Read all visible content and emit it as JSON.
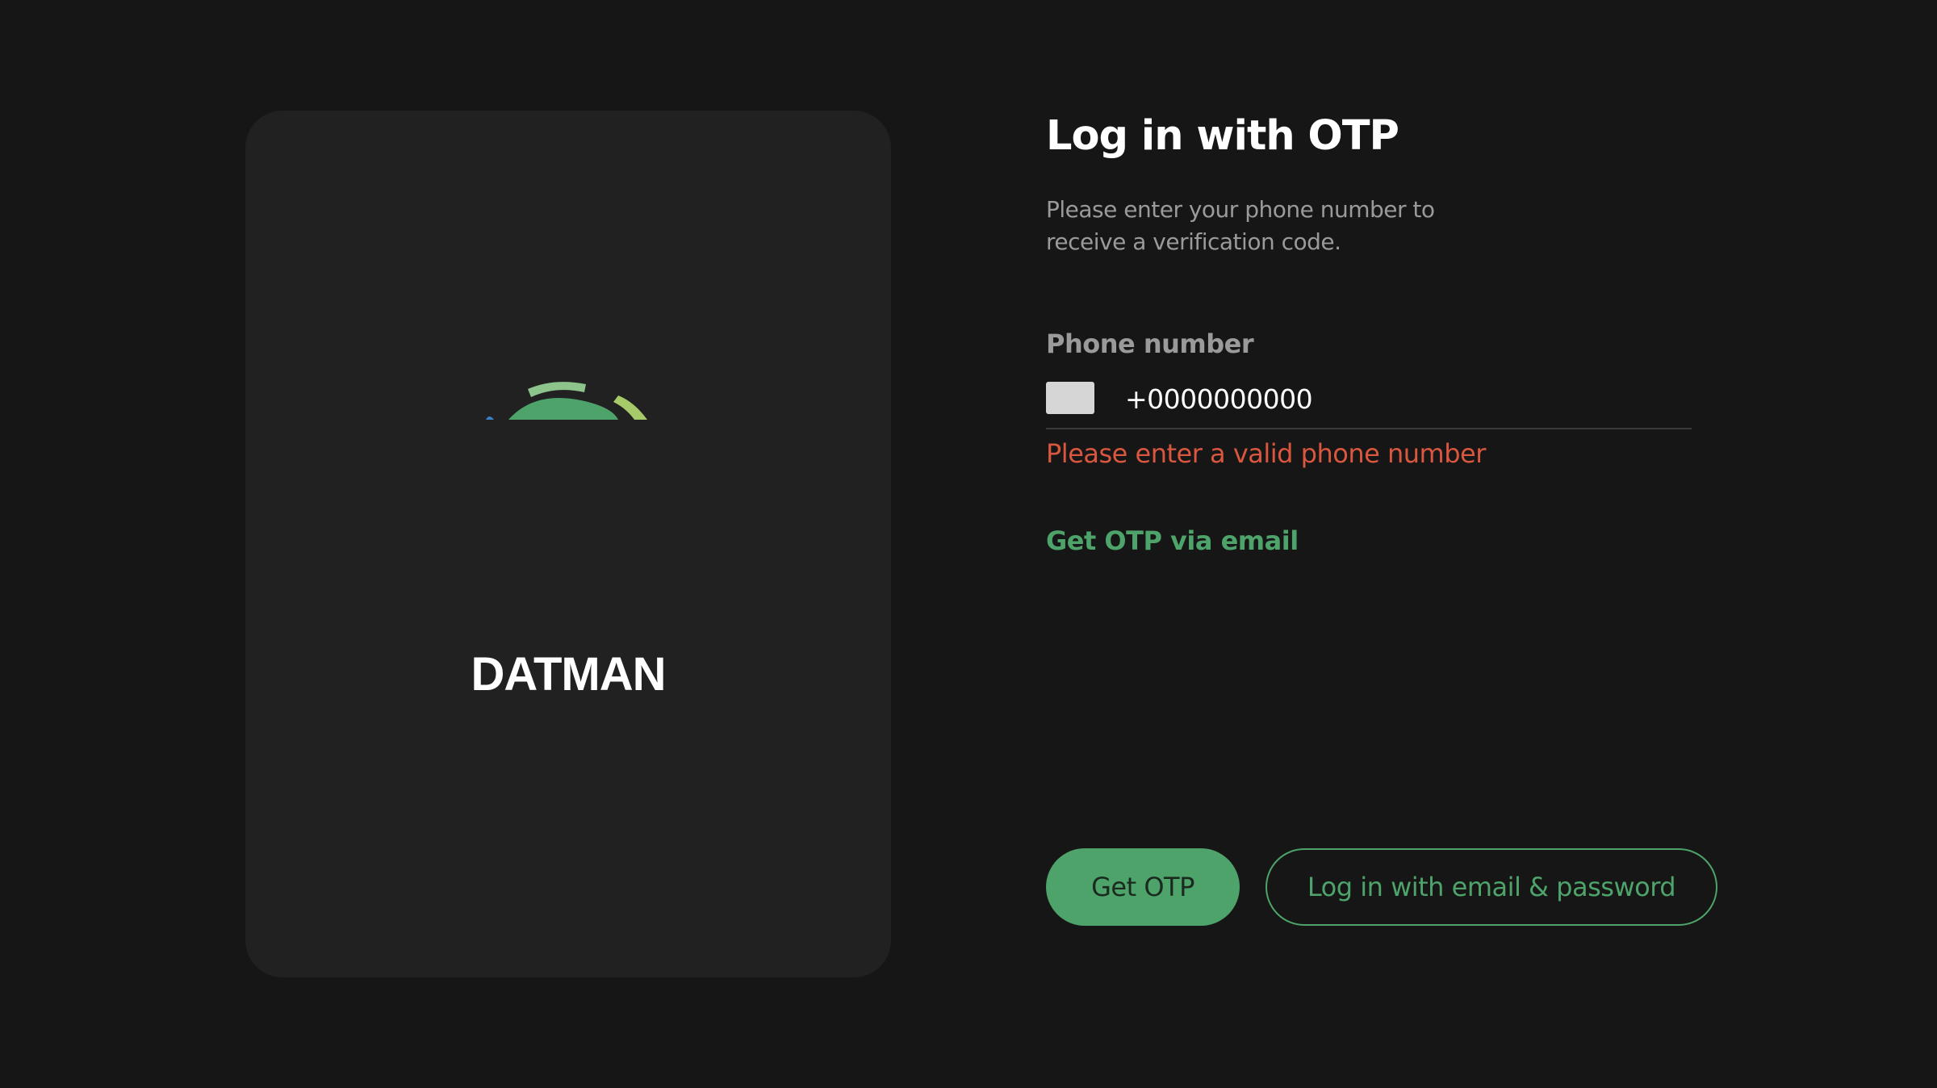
{
  "brand": {
    "name": "DATMAN",
    "logo_icon": "datman-logo-icon"
  },
  "login": {
    "title": "Log in with OTP",
    "subtitle": "Please enter your phone number to receive a verification code.",
    "phone_label": "Phone number",
    "phone_value": "+0000000000",
    "flag_icon": "country-flag-icon",
    "error": "Please enter a valid phone number",
    "otp_email_link": "Get OTP via email",
    "get_otp_button": "Get OTP",
    "email_password_button": "Log in with email & password"
  },
  "colors": {
    "background": "#161616",
    "card": "#212121",
    "accent": "#4ea36b",
    "error": "#d9573f",
    "muted_text": "#9a9a9a"
  }
}
